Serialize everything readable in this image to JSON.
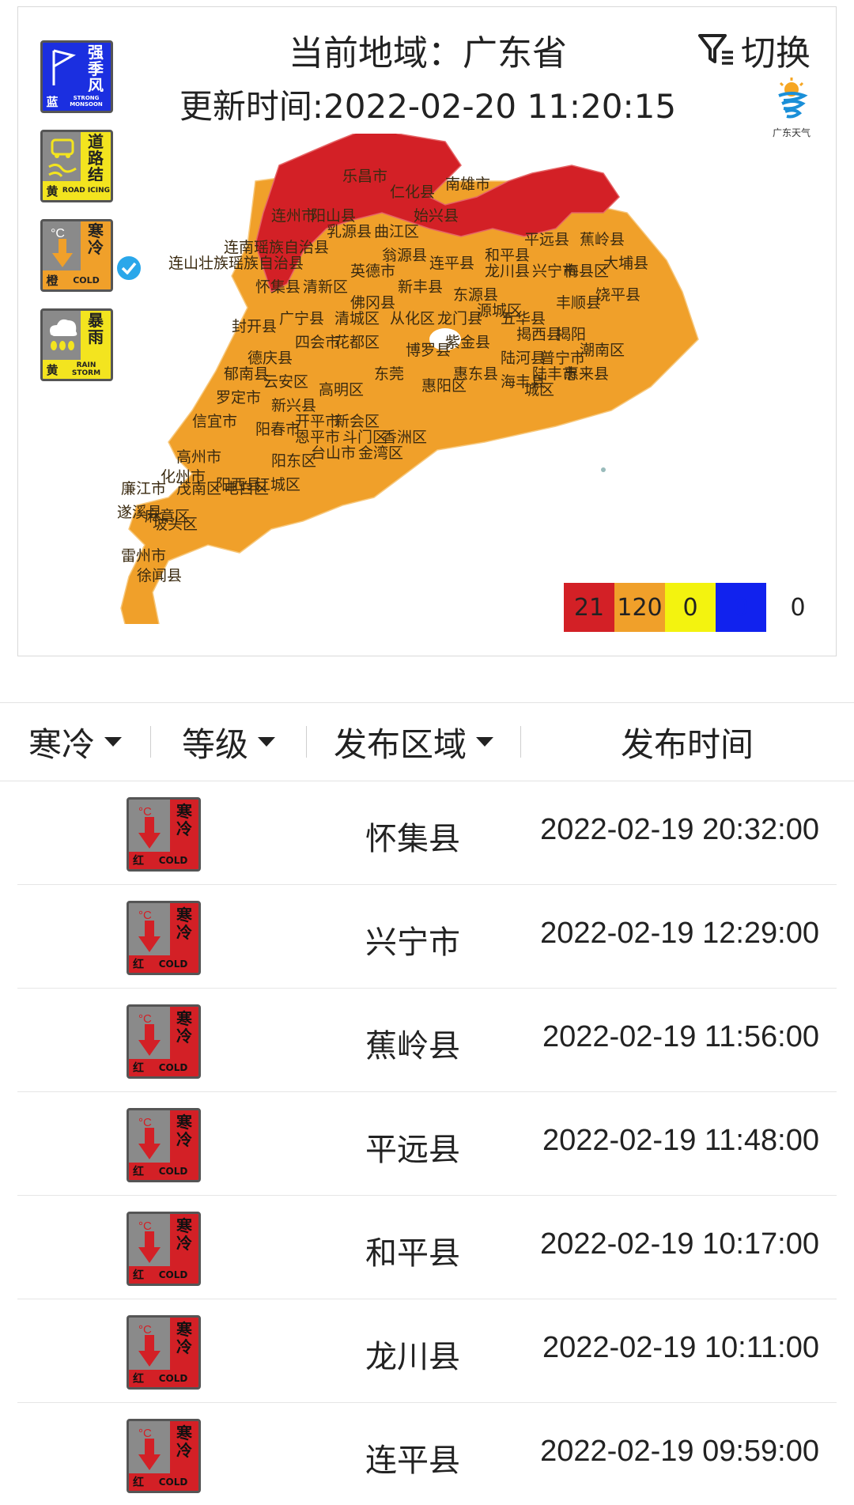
{
  "header": {
    "region_title": "当前地域：广东省",
    "update_time": "更新时间:2022-02-20 11:20:15",
    "switch_label": "切换",
    "logo_text": "广东天气"
  },
  "side_warnings": [
    {
      "type": "强季风",
      "side_text": "强季风",
      "level": "蓝",
      "english": "STRONG MONSOON",
      "color": "#1b2fe0"
    },
    {
      "type": "道路结冰",
      "side_text": "道路结冰",
      "level": "黄",
      "english": "ROAD ICING",
      "color": "#f3e41f"
    },
    {
      "type": "寒冷",
      "side_text": "寒冷",
      "level": "橙",
      "english": "COLD",
      "color": "#f0a02a",
      "selected": true
    },
    {
      "type": "暴雨",
      "side_text": "暴雨",
      "level": "黄",
      "english": "RAIN STORM",
      "color": "#f3e41f"
    }
  ],
  "map": {
    "colors": {
      "red": "#d32026",
      "orange": "#f0a02a"
    },
    "labels": [
      "乐昌市",
      "南雄市",
      "仁化县",
      "连州市",
      "阳山县",
      "乳源县",
      "曲江区",
      "始兴县",
      "连南瑶族自治县",
      "连山壮族瑶族自治县",
      "翁源县",
      "英德市",
      "连平县",
      "和平县",
      "平远县",
      "蕉岭县",
      "龙川县",
      "兴宁市",
      "梅县区",
      "大埔县",
      "怀集县",
      "清新区",
      "新丰县",
      "东源县",
      "佛冈县",
      "广宁县",
      "清城区",
      "从化区",
      "龙门县",
      "源城区",
      "五华县",
      "丰顺县",
      "饶平县",
      "封开县",
      "四会市",
      "花都区",
      "博罗县",
      "紫金县",
      "揭西县",
      "揭阳",
      "德庆县",
      "陆河县",
      "普宁市",
      "潮南区",
      "郁南县",
      "云安区",
      "惠东县",
      "东莞",
      "惠阳区",
      "海丰县",
      "陆丰市",
      "惠来县",
      "罗定市",
      "新兴县",
      "高明区",
      "城区",
      "信宜市",
      "阳春市",
      "开平市",
      "新会区",
      "斗门区",
      "香洲区",
      "恩平市",
      "台山市",
      "金湾区",
      "阳东区",
      "高州市",
      "江城区",
      "化州市",
      "阳西县",
      "廉江市",
      "茂南区",
      "电白区",
      "遂溪县",
      "麻章区",
      "坡头区",
      "雷州市",
      "徐闻县"
    ]
  },
  "legend": {
    "items": [
      {
        "value": "21",
        "color": "#d32026"
      },
      {
        "value": "120",
        "color": "#f0a02a"
      },
      {
        "value": "0",
        "color": "#f3f30f"
      },
      {
        "value": "0",
        "color": "#1122ee"
      }
    ],
    "extra_value": "0"
  },
  "filters": {
    "type_label": "寒冷",
    "level_label": "等级",
    "area_label": "发布区域",
    "time_label": "发布时间"
  },
  "warnings": [
    {
      "area": "怀集县",
      "time": "2022-02-19 20:32:00",
      "icon": "cold-red-icon",
      "side_text": "寒冷",
      "level": "红",
      "english": "COLD"
    },
    {
      "area": "兴宁市",
      "time": "2022-02-19 12:29:00",
      "icon": "cold-red-icon",
      "side_text": "寒冷",
      "level": "红",
      "english": "COLD"
    },
    {
      "area": "蕉岭县",
      "time": "2022-02-19 11:56:00",
      "icon": "cold-red-icon",
      "side_text": "寒冷",
      "level": "红",
      "english": "COLD"
    },
    {
      "area": "平远县",
      "time": "2022-02-19 11:48:00",
      "icon": "cold-red-icon",
      "side_text": "寒冷",
      "level": "红",
      "english": "COLD"
    },
    {
      "area": "和平县",
      "time": "2022-02-19 10:17:00",
      "icon": "cold-red-icon",
      "side_text": "寒冷",
      "level": "红",
      "english": "COLD"
    },
    {
      "area": "龙川县",
      "time": "2022-02-19 10:11:00",
      "icon": "cold-red-icon",
      "side_text": "寒冷",
      "level": "红",
      "english": "COLD"
    },
    {
      "area": "连平县",
      "time": "2022-02-19 09:59:00",
      "icon": "cold-red-icon",
      "side_text": "寒冷",
      "level": "红",
      "english": "COLD"
    }
  ]
}
